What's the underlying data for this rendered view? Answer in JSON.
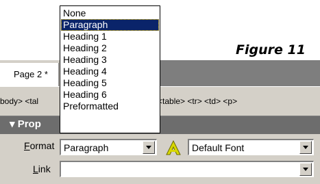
{
  "caption": "Figure 11",
  "tabs": {
    "page": "Page 2 *"
  },
  "tag_selector": {
    "left": "body> <tal",
    "right": "<table> <tr> <td> <p>"
  },
  "properties": {
    "title": "▾ Prop",
    "format_label": "Format",
    "format_label_mnemonic": "F",
    "format_label_rest": "ormat",
    "format_value": "Paragraph",
    "font_value": "Default Font",
    "link_label_mnemonic": "L",
    "link_label_rest": "ink",
    "link_value": ""
  },
  "format_options": [
    "None",
    "Paragraph",
    "Heading 1",
    "Heading 2",
    "Heading 3",
    "Heading 4",
    "Heading 5",
    "Heading 6",
    "Preformatted"
  ],
  "selected_option": "Paragraph",
  "icons": {
    "font_icon": "letter-a-icon",
    "dropdown_arrow": "chevron-down-icon"
  },
  "colors": {
    "selection": "#0a246a",
    "panel": "#d4d0c8",
    "header": "#6d6d6d"
  }
}
